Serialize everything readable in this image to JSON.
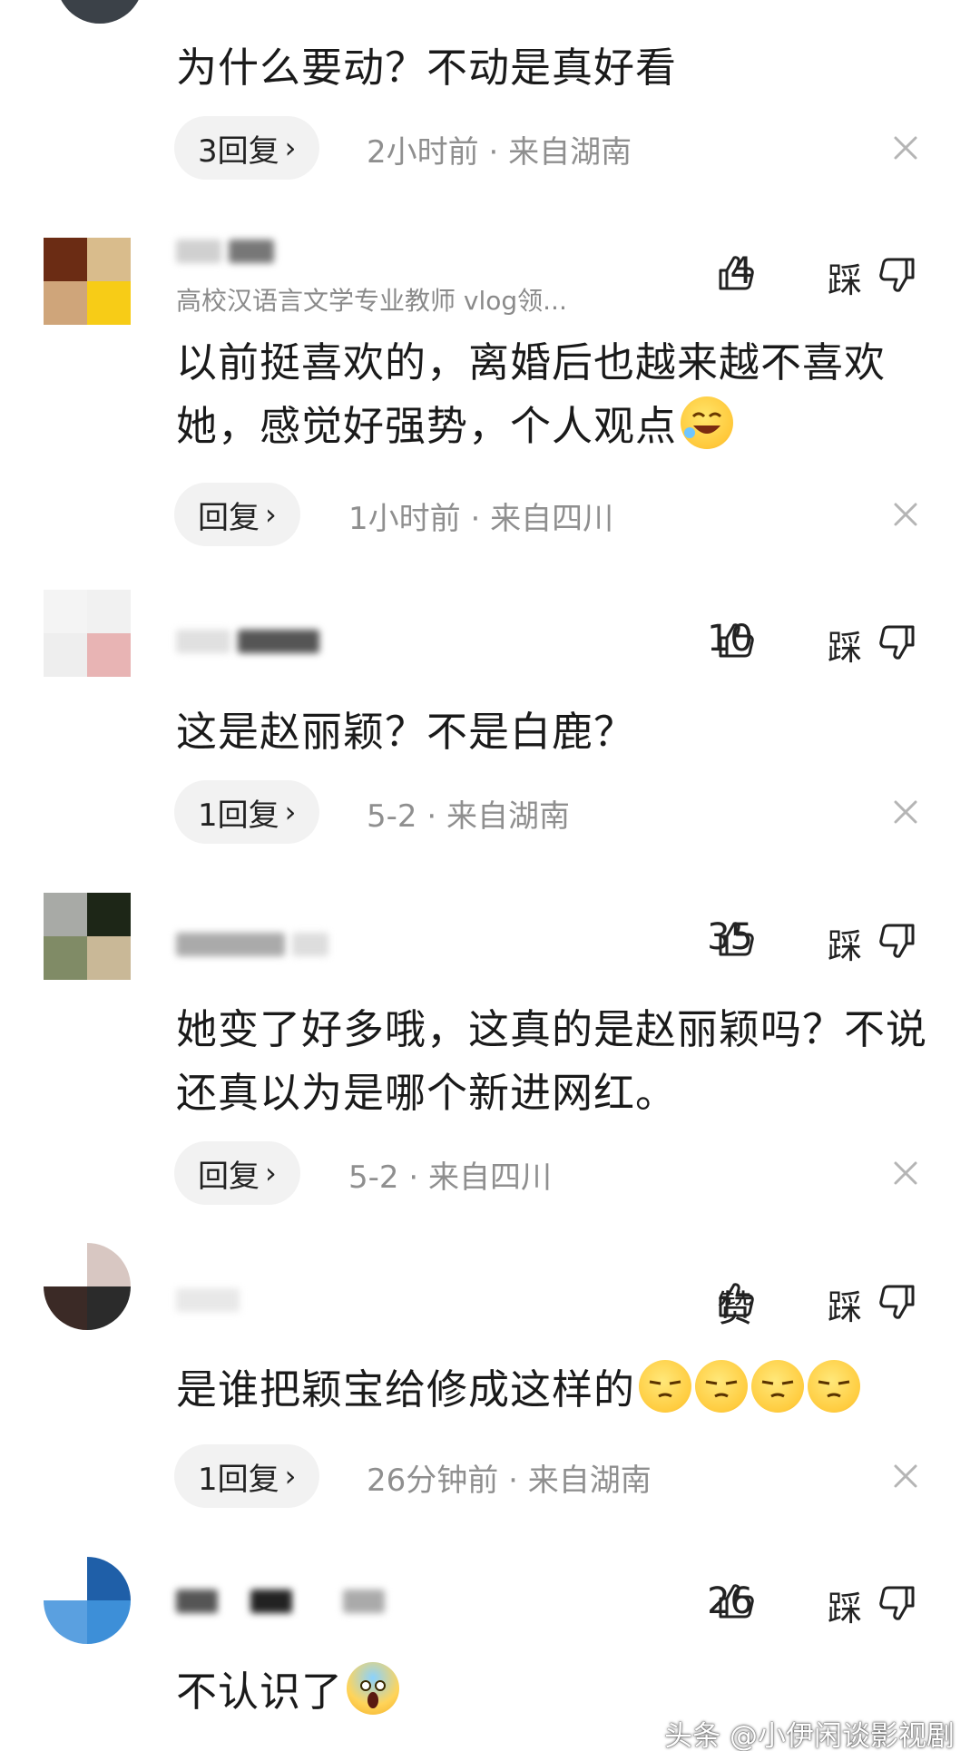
{
  "comments": [
    {
      "text": "为什么要动？不动是真好看",
      "reply_label": "3回复",
      "time": "2小时前",
      "location": "来自湖南"
    },
    {
      "subtitle": "高校汉语言文学专业教师 vlog领...",
      "likes": "4",
      "dislike_label": "踩",
      "text": "以前挺喜欢的，离婚后也越来越不喜欢她，感觉好强势，个人观点",
      "reply_label": "回复",
      "time": "1小时前",
      "location": "来自四川"
    },
    {
      "likes": "10",
      "dislike_label": "踩",
      "text": "这是赵丽颖？不是白鹿？",
      "reply_label": "1回复",
      "time": "5-2",
      "location": "来自湖南"
    },
    {
      "likes": "35",
      "dislike_label": "踩",
      "text": "她变了好多哦，这真的是赵丽颖吗？不说还真以为是哪个新进网红。",
      "reply_label": "回复",
      "time": "5-2",
      "location": "来自四川"
    },
    {
      "likes": "赞",
      "dislike_label": "踩",
      "text": "是谁把颖宝给修成这样的",
      "reply_label": "1回复",
      "time": "26分钟前",
      "location": "来自湖南"
    },
    {
      "likes": "26",
      "dislike_label": "踩",
      "text": "不认识了"
    }
  ],
  "separator": "·",
  "reply_chevron": "›",
  "watermark": "头条 @小伊闲谈影视剧",
  "colors": {
    "meta": "#8f8f8f",
    "reply_bg": "#f2f2f2",
    "text": "#1a1a1a"
  },
  "icons": [
    "thumbs-up-icon",
    "thumbs-down-icon",
    "close-icon",
    "chevron-right-icon"
  ]
}
